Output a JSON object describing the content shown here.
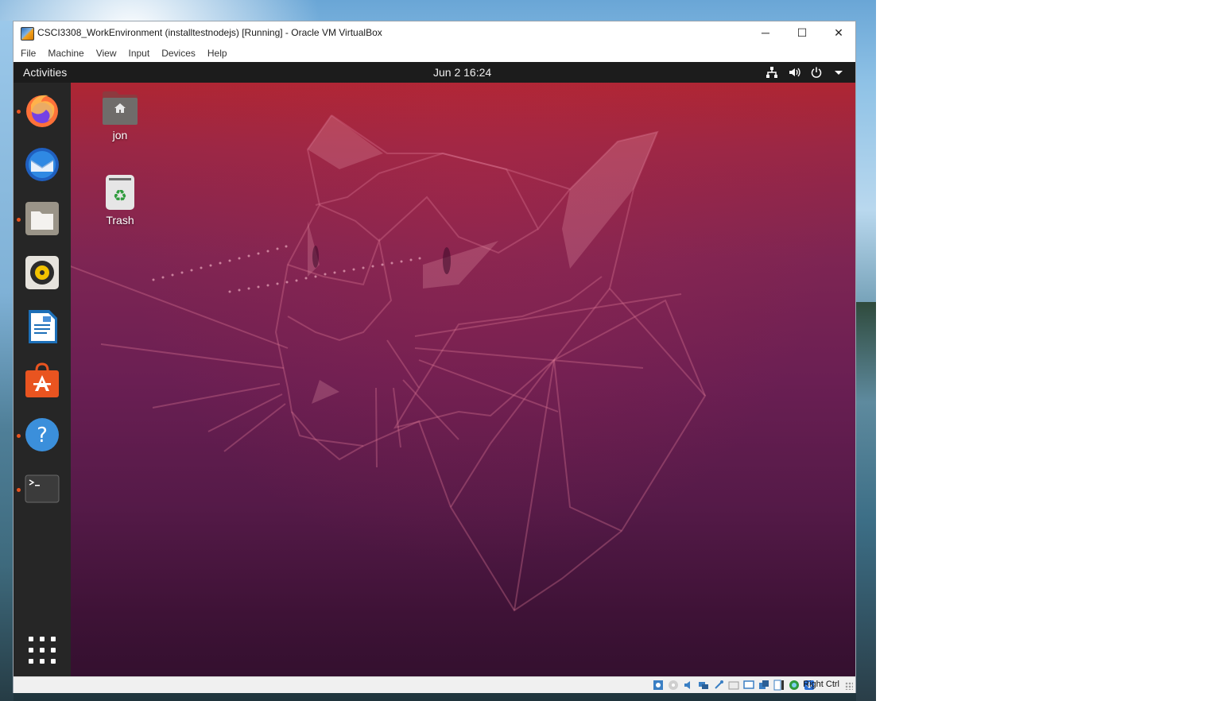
{
  "window": {
    "title": "CSCI3308_WorkEnvironment (installtestnodejs) [Running] - Oracle VM VirtualBox",
    "controls": {
      "minimize": "─",
      "maximize": "☐",
      "close": "✕"
    }
  },
  "menubar": {
    "items": [
      "File",
      "Machine",
      "View",
      "Input",
      "Devices",
      "Help"
    ]
  },
  "guest": {
    "topbar": {
      "activities": "Activities",
      "clock": "Jun 2  16:24",
      "tray_icons": [
        "network-icon",
        "volume-icon",
        "power-icon",
        "dropdown-arrow-icon"
      ]
    },
    "dock": {
      "items": [
        {
          "name": "firefox-icon",
          "running": true
        },
        {
          "name": "thunderbird-icon",
          "running": false
        },
        {
          "name": "files-icon",
          "running": true
        },
        {
          "name": "rhythmbox-icon",
          "running": false
        },
        {
          "name": "libreoffice-writer-icon",
          "running": false
        },
        {
          "name": "ubuntu-software-icon",
          "running": false
        },
        {
          "name": "help-icon",
          "running": true
        },
        {
          "name": "terminal-icon",
          "running": true
        }
      ],
      "show_apps_icon": "apps-grid-icon"
    },
    "desktop_icons": [
      {
        "label": "jon",
        "icon": "home-folder-icon"
      },
      {
        "label": "Trash",
        "icon": "trash-icon"
      }
    ]
  },
  "statusbar": {
    "icons": [
      "hard-disk-icon",
      "optical-drive-icon",
      "audio-icon",
      "network-adapter-icon",
      "usb-icon",
      "shared-folder-icon",
      "display-icon",
      "video-capture-icon",
      "recording-icon",
      "virtualization-icon",
      "keyboard-capture-icon",
      "mouse-integration-icon"
    ],
    "host_key": "Right Ctrl"
  },
  "colors": {
    "ubuntu_orange": "#e95420",
    "wallpaper_top": "#b5262d",
    "wallpaper_bottom": "#34102f",
    "dock_bg": "#262626",
    "topbar_bg": "#1c1c1c"
  }
}
